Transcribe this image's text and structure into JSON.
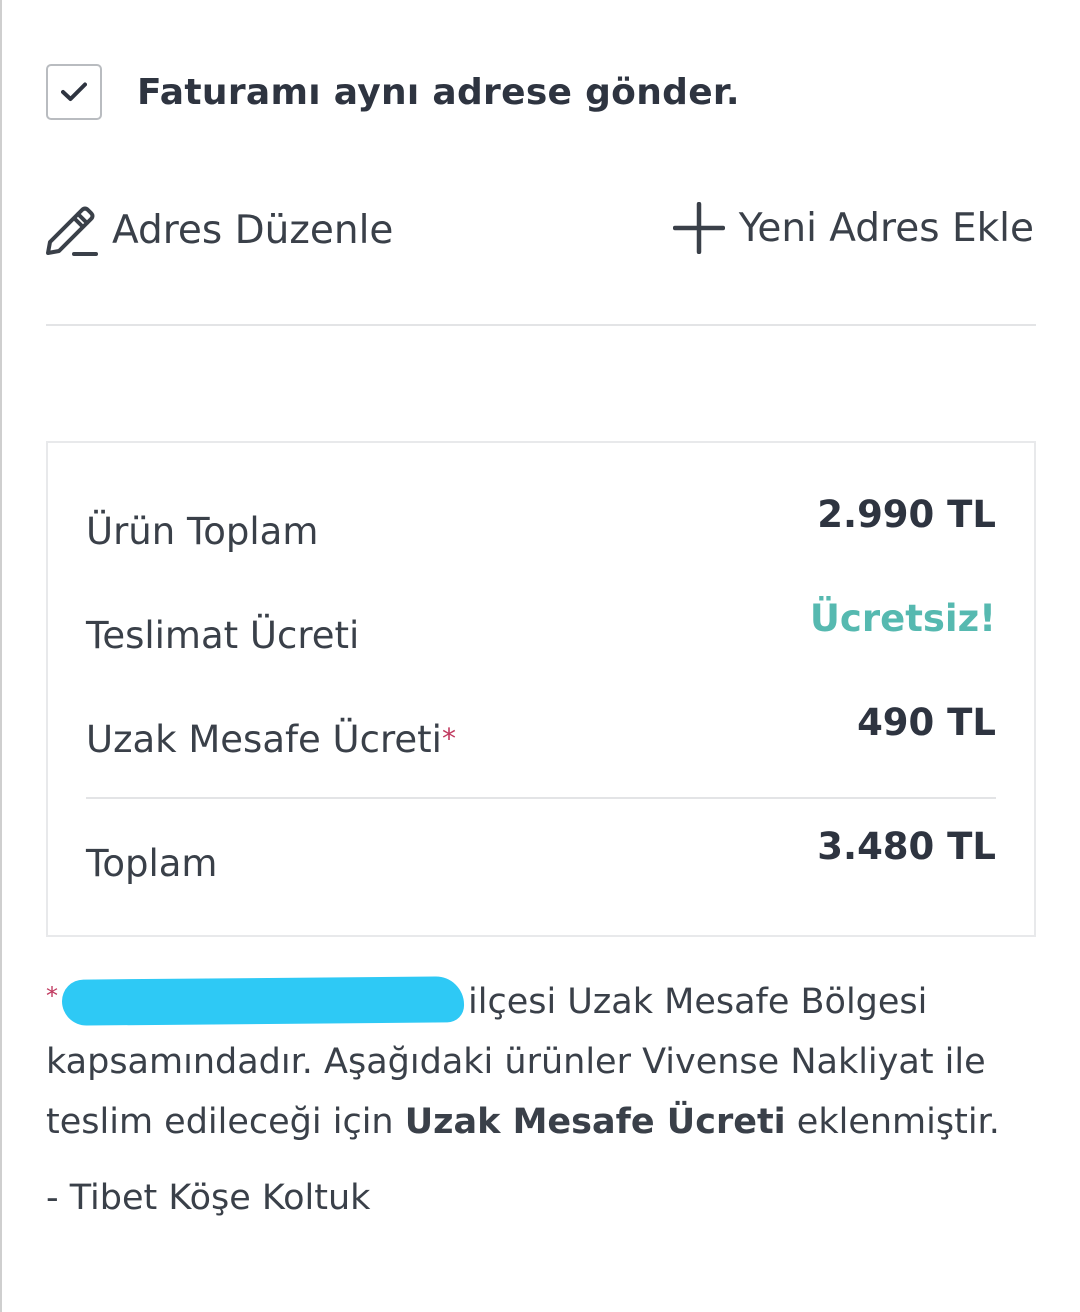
{
  "billing": {
    "checked": true,
    "label": "Faturamı aynı adrese gönder."
  },
  "actions": {
    "edit_label": "Adres Düzenle",
    "add_label": "Yeni Adres Ekle"
  },
  "summary": {
    "rows": [
      {
        "label": "Ürün Toplam",
        "value": "2.990 TL"
      },
      {
        "label": "Teslimat Ücreti",
        "value": "Ücretsiz!"
      },
      {
        "label": "Uzak Mesafe Ücreti",
        "asterisk": "*",
        "value": "490 TL"
      }
    ],
    "total": {
      "label": "Toplam",
      "value": "3.480 TL"
    }
  },
  "note": {
    "star": "*",
    "line1_rest": "ilçesi Uzak Mesafe Bölgesi",
    "line2": "kapsamındadır. Aşağıdaki ürünler Vivense Nakliyat ile",
    "line3_pre": "teslim edileceği için ",
    "line3_bold": "Uzak Mesafe Ücreti",
    "line3_post": " eklenmiştir.",
    "product": "- Tibet Köşe Koltuk"
  },
  "colors": {
    "free_value": "#56b9b0",
    "asterisk": "#c0395f",
    "redaction": "#2ec9f5"
  }
}
